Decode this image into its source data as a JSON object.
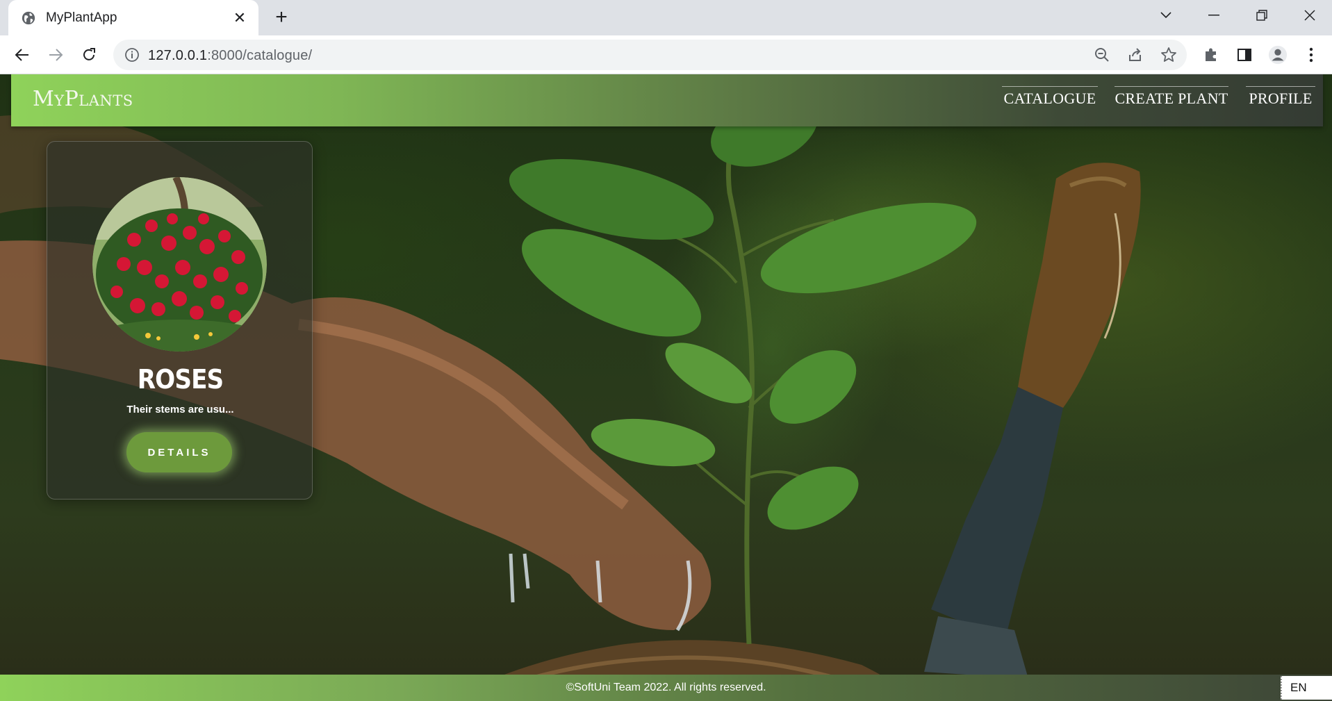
{
  "browser": {
    "tab_title": "MyPlantApp",
    "tab_close": "✕",
    "new_tab": "+",
    "url_host": "127.0.0.1",
    "url_rest": ":8000/catalogue/"
  },
  "site": {
    "logo": "MyPlants",
    "nav": [
      {
        "label": "CATALOGUE"
      },
      {
        "label": "CREATE PLANT"
      },
      {
        "label": "PROFILE"
      }
    ]
  },
  "catalogue": {
    "cards": [
      {
        "name": "ROSES",
        "description": "Their stems are usu...",
        "button_label": "DETAILS"
      }
    ]
  },
  "footer": {
    "text": "©SoftUni Team 2022. All rights reserved.",
    "language": "EN"
  },
  "colors": {
    "header_green": "#8fd25a",
    "button_green": "#6d9a3c"
  }
}
